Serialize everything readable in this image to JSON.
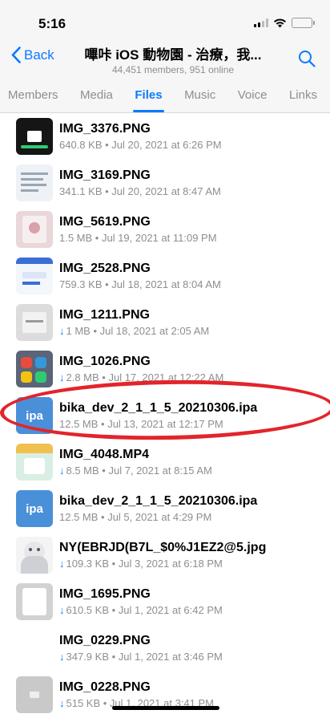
{
  "status": {
    "time": "5:16"
  },
  "nav": {
    "back_label": "Back",
    "title": "嗶咔 iOS 動物園 - 治療，我...",
    "subtitle": "44,451 members, 951 online"
  },
  "tabs": [
    {
      "label": "Members"
    },
    {
      "label": "Media"
    },
    {
      "label": "Files"
    },
    {
      "label": "Music"
    },
    {
      "label": "Voice"
    },
    {
      "label": "Links"
    }
  ],
  "active_tab": "Files",
  "files": [
    {
      "name": "IMG_3376.PNG",
      "meta": "640.8 KB • Jul 20, 2021 at 6:26 PM",
      "download": false
    },
    {
      "name": "IMG_3169.PNG",
      "meta": "341.1 KB • Jul 20, 2021 at 8:47 AM",
      "download": false
    },
    {
      "name": "IMG_5619.PNG",
      "meta": "1.5 MB • Jul 19, 2021 at 11:09 PM",
      "download": false
    },
    {
      "name": "IMG_2528.PNG",
      "meta": "759.3 KB • Jul 18, 2021 at 8:04 AM",
      "download": false
    },
    {
      "name": "IMG_1211.PNG",
      "meta": "1 MB • Jul 18, 2021 at 2:05 AM",
      "download": true
    },
    {
      "name": "IMG_1026.PNG",
      "meta": "2.8 MB • Jul 17, 2021 at 12:22 AM",
      "download": true
    },
    {
      "name": "bika_dev_2_1_1_5_20210306.ipa",
      "meta": "12.5 MB • Jul 13, 2021 at 12:17 PM",
      "download": false,
      "thumb_text": "ipa"
    },
    {
      "name": "IMG_4048.MP4",
      "meta": "8.5 MB • Jul 7, 2021 at 8:15 AM",
      "download": true
    },
    {
      "name": "bika_dev_2_1_1_5_20210306.ipa",
      "meta": "12.5 MB • Jul 5, 2021 at 4:29 PM",
      "download": false,
      "thumb_text": "ipa"
    },
    {
      "name": "NY(EBRJD(B7L_$0%J1EZ2@5.jpg",
      "meta": "109.3 KB • Jul 3, 2021 at 6:18 PM",
      "download": true
    },
    {
      "name": "IMG_1695.PNG",
      "meta": "610.5 KB • Jul 1, 2021 at 6:42 PM",
      "download": true
    },
    {
      "name": "IMG_0229.PNG",
      "meta": "347.9 KB • Jul 1, 2021 at 3:46 PM",
      "download": true
    },
    {
      "name": "IMG_0228.PNG",
      "meta": "515 KB • Jul 1, 2021 at 3:41 PM",
      "download": true
    }
  ],
  "colors": {
    "accent": "#0a7aff",
    "annotation": "#e3242b",
    "ipa": "#4a90d9"
  }
}
